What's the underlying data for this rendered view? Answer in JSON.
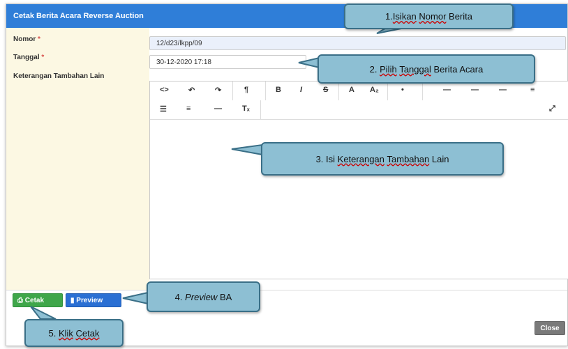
{
  "modal": {
    "title": "Cetak Berita Acara Reverse Auction"
  },
  "form": {
    "nomor_label": "Nomor",
    "nomor_value": "12/d23/lkpp/09",
    "tanggal_label": "Tanggal",
    "tanggal_value": "30-12-2020 17:18",
    "keterangan_label": "Keterangan Tambahan Lain",
    "required_mark": "*"
  },
  "editor": {
    "toolbar_row1": [
      "<>",
      "↶",
      "↷",
      "¶",
      "B",
      "I",
      "S",
      "A",
      "A₂",
      "•",
      "—",
      "—",
      "—",
      "≡"
    ],
    "toolbar_row2": [
      "☰",
      "≡",
      "—",
      "Tₓ",
      "⤢"
    ]
  },
  "buttons": {
    "cetak": "Cetak",
    "preview": "Preview",
    "close": "Close"
  },
  "callouts": {
    "c1_prefix": "1.",
    "c1_word1": "Isikan",
    "c1_word2": "Nomor",
    "c1_word3": "Berita",
    "c2_prefix": "2.",
    "c2_word1": "Pilih",
    "c2_word2": "Tanggal",
    "c2_rest": "Berita Acara",
    "c3_prefix": "3. Isi",
    "c3_word1": "Keterangan",
    "c3_word2": "Tambahan",
    "c3_rest": "Lain",
    "c4_prefix": "4.",
    "c4_italic": "Preview",
    "c4_rest": "BA",
    "c5_prefix": "5.",
    "c5_word1": "Klik",
    "c5_word2": "Cetak"
  }
}
